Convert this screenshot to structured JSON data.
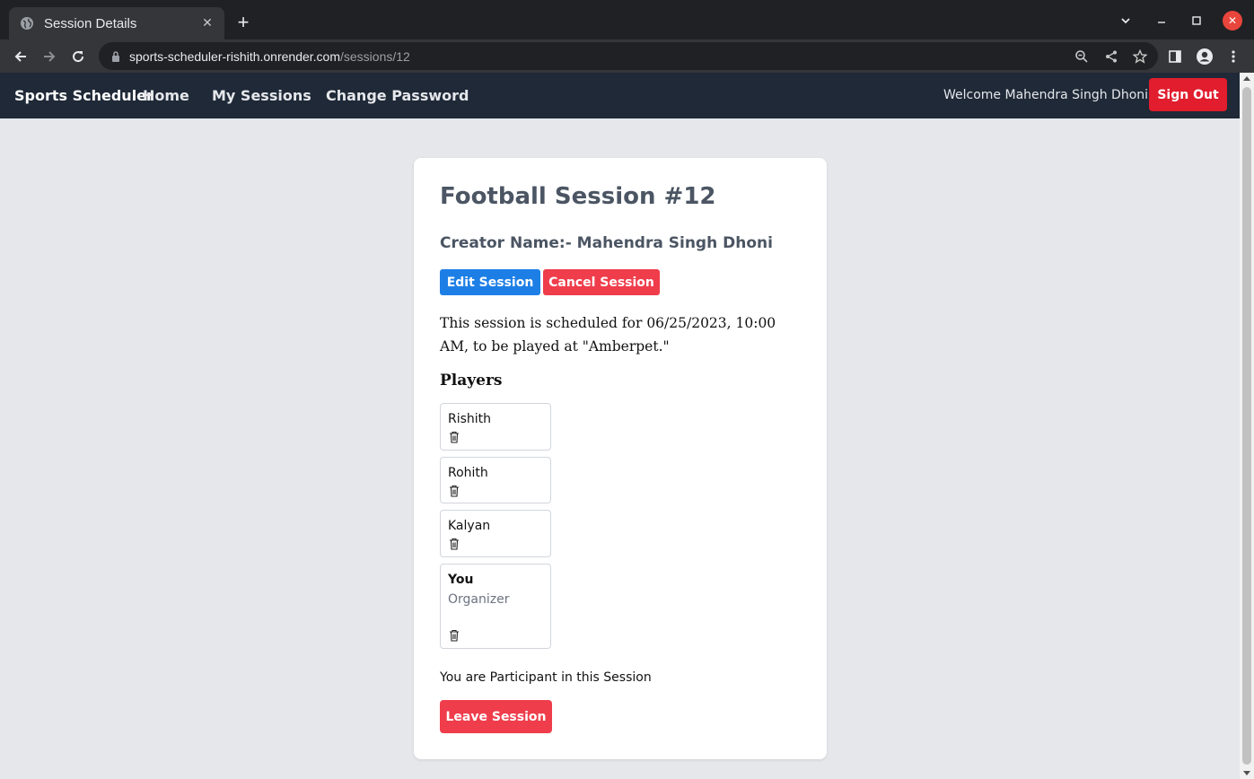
{
  "browser": {
    "tab_title": "Session Details",
    "url_host": "sports-scheduler-rishith.onrender.com",
    "url_path": "/sessions/12"
  },
  "navbar": {
    "brand": "Sports Scheduler",
    "links": [
      "Home",
      "My Sessions",
      "Change Password"
    ],
    "welcome": "Welcome Mahendra Singh Dhoni",
    "signout_label": "Sign Out"
  },
  "session": {
    "title": "Football Session #12",
    "creator": "Creator Name:- Mahendra Singh Dhoni",
    "edit_label": "Edit Session",
    "cancel_label": "Cancel Session",
    "description": "This session is scheduled for 06/25/2023, 10:00 AM, to be played at \"Amberpet.\"",
    "players_heading": "Players",
    "players": [
      {
        "name": "Rishith"
      },
      {
        "name": "Rohith"
      },
      {
        "name": "Kalyan"
      },
      {
        "name": "You",
        "role": "Organizer"
      }
    ],
    "participant_text": "You are Participant in this Session",
    "leave_label": "Leave Session"
  },
  "colors": {
    "navbar_bg": "#1f2937",
    "signout": "#e11d2e",
    "edit": "#1d7fe6",
    "danger": "#ef3d4b",
    "page_bg": "#e5e7eb"
  },
  "icons": [
    "globe-icon",
    "close-icon",
    "plus-icon",
    "chevron-down-icon",
    "minimize-icon",
    "maximize-icon",
    "back-icon",
    "forward-icon",
    "reload-icon",
    "lock-icon",
    "zoom-icon",
    "share-icon",
    "star-icon",
    "side-panel-icon",
    "profile-icon",
    "menu-icon",
    "trash-icon"
  ]
}
